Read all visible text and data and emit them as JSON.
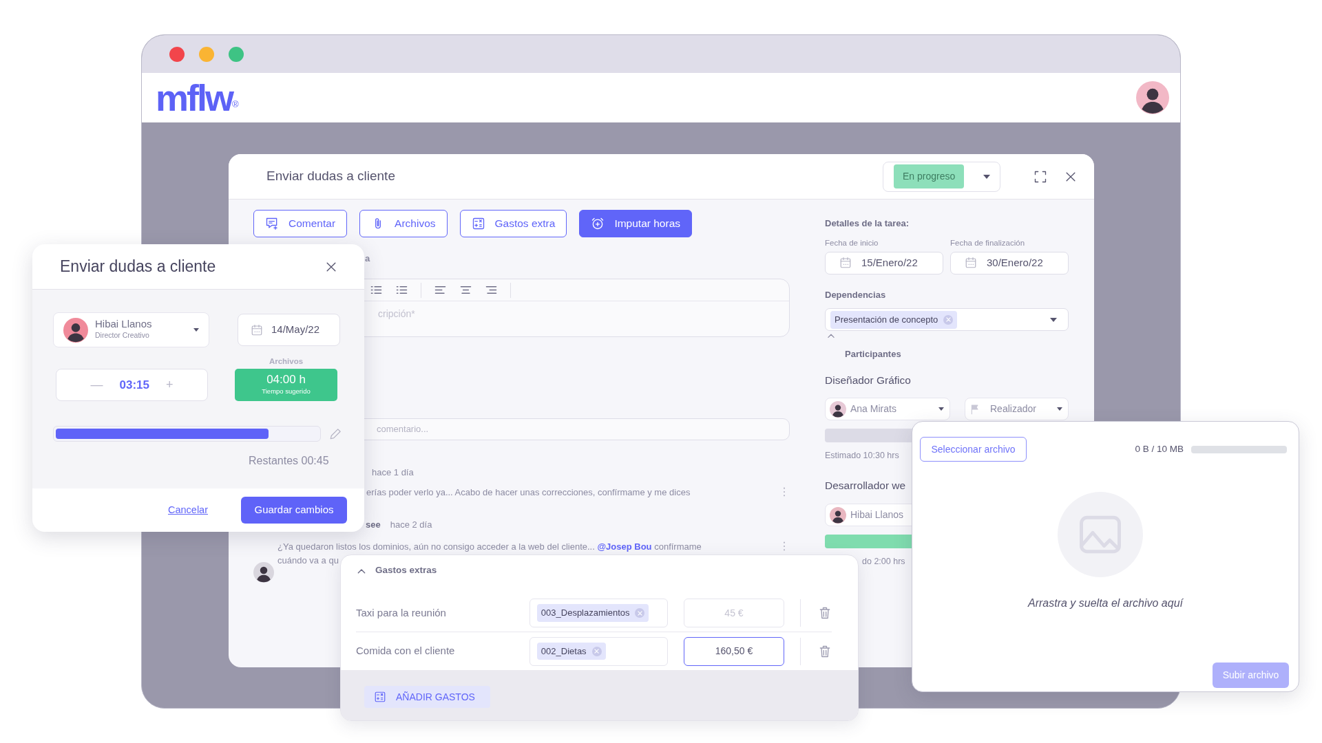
{
  "window": {
    "traffic_lights": [
      {
        "color": "#f2454b"
      },
      {
        "color": "#fab433"
      },
      {
        "color": "#3ec384"
      }
    ]
  },
  "app_header": {
    "logo": "mflw",
    "logo_mark": "®"
  },
  "main_modal": {
    "title": "Enviar dudas a cliente",
    "status": "En progreso",
    "actions": [
      {
        "label": "Comentar",
        "selected": false
      },
      {
        "label": "Archivos",
        "selected": false
      },
      {
        "label": "Gastos extra",
        "selected": false
      },
      {
        "label": "Imputar horas",
        "selected": true
      }
    ],
    "description_label": "a",
    "editor_placeholder": "cripción*",
    "comment_placeholder": "comentario...",
    "comments": [
      {
        "time": "hace 1 día",
        "lines": [
          "erías poder verlo ya... Acabo de hacer unas correcciones, confírmame y me dices"
        ]
      },
      {
        "author": "see",
        "time": "hace 2 día",
        "lines": [
          "¿Ya quedaron listos los dominios, aún no consigo acceder a la web del cliente... **@Josep Bou** confírmame",
          "cuándo va a qu"
        ]
      }
    ],
    "details": {
      "heading": "Detalles de la tarea:",
      "start_label": "Fecha de inicio",
      "start_date": "15/Enero/22",
      "end_label": "Fecha de finalización",
      "end_date": "30/Enero/22",
      "dependencies_label": "Dependencias",
      "dependencies": [
        "Presentación de concepto"
      ],
      "participants_label": "Participantes",
      "roles": [
        {
          "title": "Diseñador Gráfico",
          "person": "Ana Mirats",
          "role_select": "Realizador",
          "color": "#dcdbe6",
          "estimate": "Estimado 10:30 hrs"
        },
        {
          "title": "Desarrollador we",
          "person": "Hibai Llanos",
          "color": "#7fdcae",
          "estimate": "do 2:00 hrs"
        }
      ]
    }
  },
  "left_modal": {
    "title": "Enviar dudas a cliente",
    "person": "Hibai Llanos",
    "person_role": "Director Creativo",
    "date": "14/May/22",
    "faint_label": "Archivos",
    "time": "03:15",
    "minus": "—",
    "plus": "+",
    "suggested_value": "04:00 h",
    "suggested_label": "Tiempo sugerido",
    "level": 0.81,
    "remaining": "Restantes 00:45",
    "cancel": "Cancelar",
    "save": "Guardar cambios"
  },
  "expenses": {
    "title": "Gastos extras",
    "expanded": true,
    "rows": [
      {
        "concept": "Taxi para la reunión",
        "tag": "003_Desplazamientos",
        "amount": "45 €",
        "focused": false
      },
      {
        "concept": "Comida con el cliente",
        "tag": "002_Dietas",
        "amount": "160,50 €",
        "focused": true
      }
    ],
    "add_button": "AÑADIR GASTOS"
  },
  "upload": {
    "select_button": "Seleccionar archivo",
    "size": "0 B / 10 MB",
    "drop_text": "Arrastra y suelta el archivo aquí",
    "submit": "Subir archivo",
    "submit_disabled": true
  }
}
